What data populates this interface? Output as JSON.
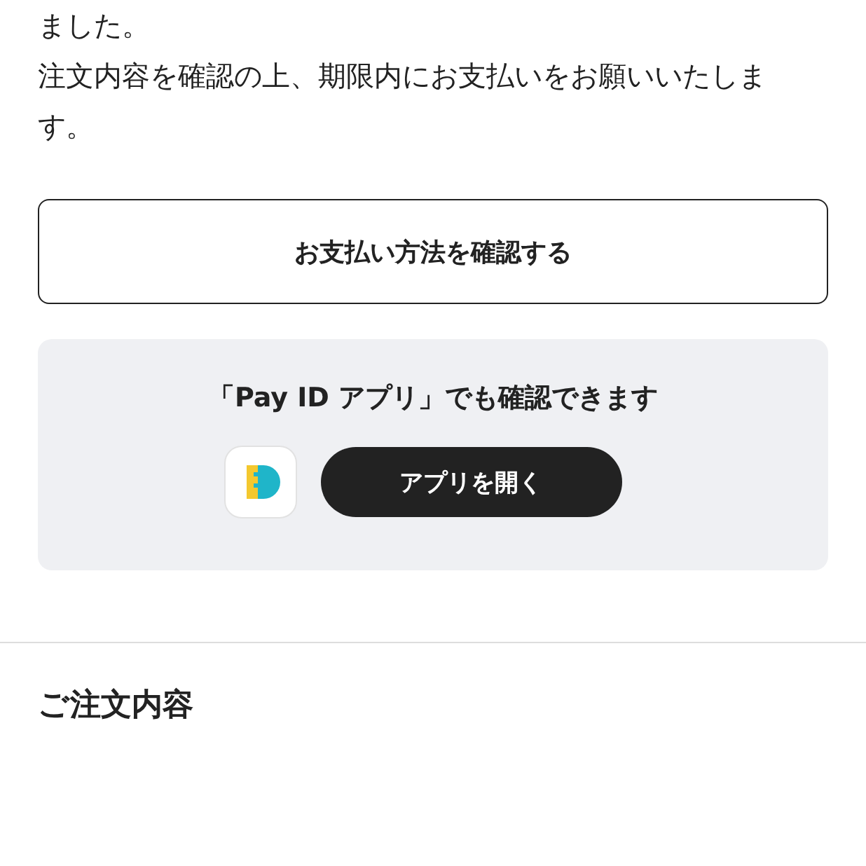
{
  "message_lines": [
    "ました。",
    "注文内容を確認の上、期限内にお支払いをお願いいたします。"
  ],
  "payment_button": "お支払い方法を確認する",
  "app_card": {
    "title": "「Pay ID アプリ」でも確認できます",
    "open_button": "アプリを開く"
  },
  "section_title": "ご注文内容"
}
